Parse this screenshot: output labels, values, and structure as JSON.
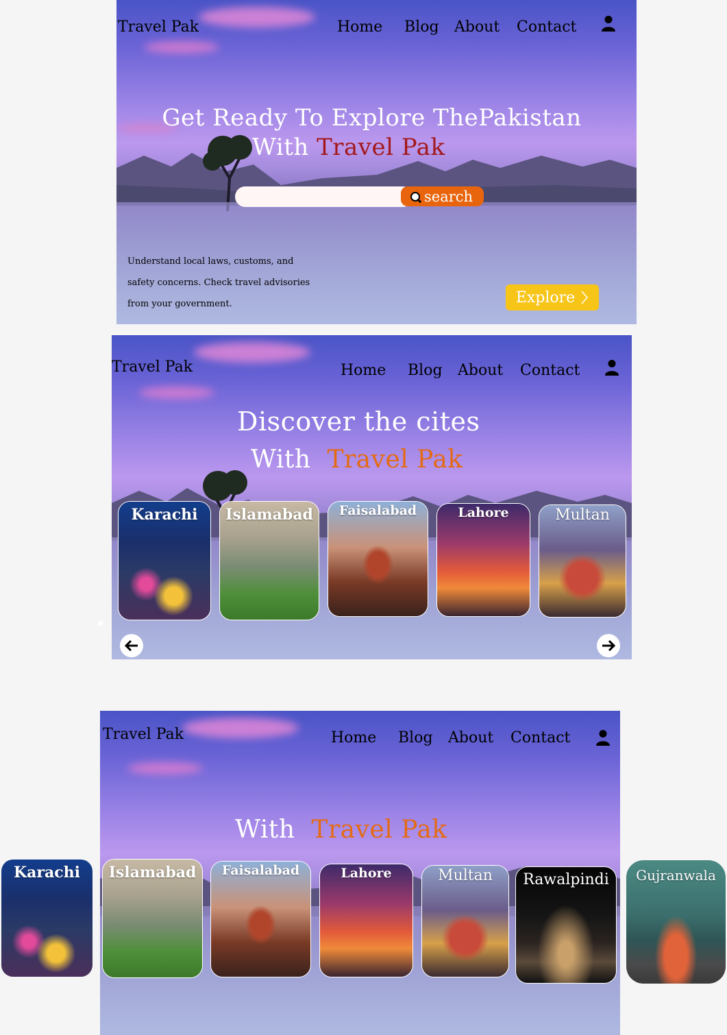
{
  "frame1": {
    "logo": "Travel Pak",
    "nav": [
      "Home",
      "Blog",
      "About",
      "Contact"
    ],
    "user_icon": "user-icon",
    "title_line1": "Get Ready To Explore ThePakistan",
    "title_with": "With",
    "title_brand": "Travel Pak",
    "search": {
      "placeholder": "",
      "button_label": "search",
      "icon": "search-icon"
    },
    "blurb": "Understand local laws, customs, and safety concerns. Check travel advisories from your government.",
    "explore_label": "Explore",
    "explore_icon": "chevron-right-icon"
  },
  "frame2": {
    "logo": "Travel Pak",
    "nav": [
      "Home",
      "Blog",
      "About",
      "Contact"
    ],
    "title_line1": "Discover the cites",
    "title_with": "With",
    "title_brand": "Travel Pak",
    "cities": [
      "Karachi",
      "Islamabad",
      "Faisalabad",
      "Lahore",
      "Multan"
    ],
    "prev_icon": "arrow-left-icon",
    "next_icon": "arrow-right-icon"
  },
  "frame3": {
    "logo": "Travel Pak",
    "nav": [
      "Home",
      "Blog",
      "About",
      "Contact"
    ],
    "title_with": "With",
    "title_brand": "Travel Pak",
    "cities": [
      "Karachi",
      "Islamabad",
      "Faisalabad",
      "Lahore",
      "Multan",
      "Rawalpindi",
      "Gujranwala"
    ]
  },
  "colors": {
    "brand_red": "#a3181a",
    "brand_orange": "#e56a14",
    "search_button": "#e8650e",
    "explore_button": "#f7c418"
  }
}
